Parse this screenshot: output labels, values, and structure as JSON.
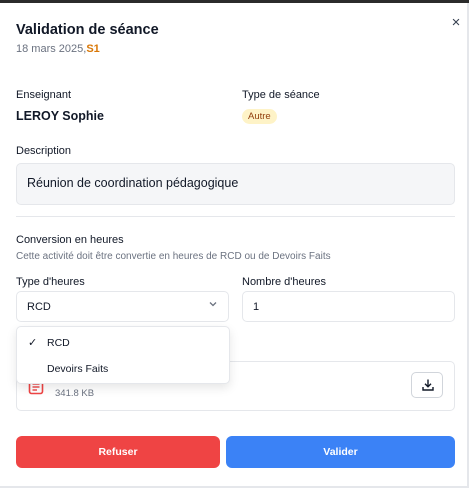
{
  "dialog": {
    "title": "Validation de séance",
    "date": "18 mars 2025,",
    "session": "S1",
    "close_glyph": "×"
  },
  "teacher": {
    "label": "Enseignant",
    "value": "LEROY Sophie"
  },
  "session_type": {
    "label": "Type de séance",
    "badge": "Autre"
  },
  "description": {
    "label": "Description",
    "value": "Réunion de coordination pédagogique"
  },
  "conversion": {
    "title": "Conversion en heures",
    "help": "Cette activité doit être convertie en heures de RCD ou de Devoirs Faits",
    "hour_type": {
      "label": "Type d'heures",
      "selected": "RCD",
      "options": [
        "RCD",
        "Devoirs Faits"
      ],
      "check_glyph": "✓"
    },
    "hour_count": {
      "label": "Nombre d'heures",
      "value": "1"
    }
  },
  "attachment": {
    "size": "341.8 KB",
    "icon": "document-icon",
    "download_icon": "download-icon"
  },
  "actions": {
    "refuse": "Refuser",
    "validate": "Valider"
  },
  "colors": {
    "refuse": "#ef4444",
    "validate": "#3b82f6",
    "session_accent": "#d97706",
    "badge_bg": "#fef3c7",
    "attachment_icon": "#ef4444"
  }
}
